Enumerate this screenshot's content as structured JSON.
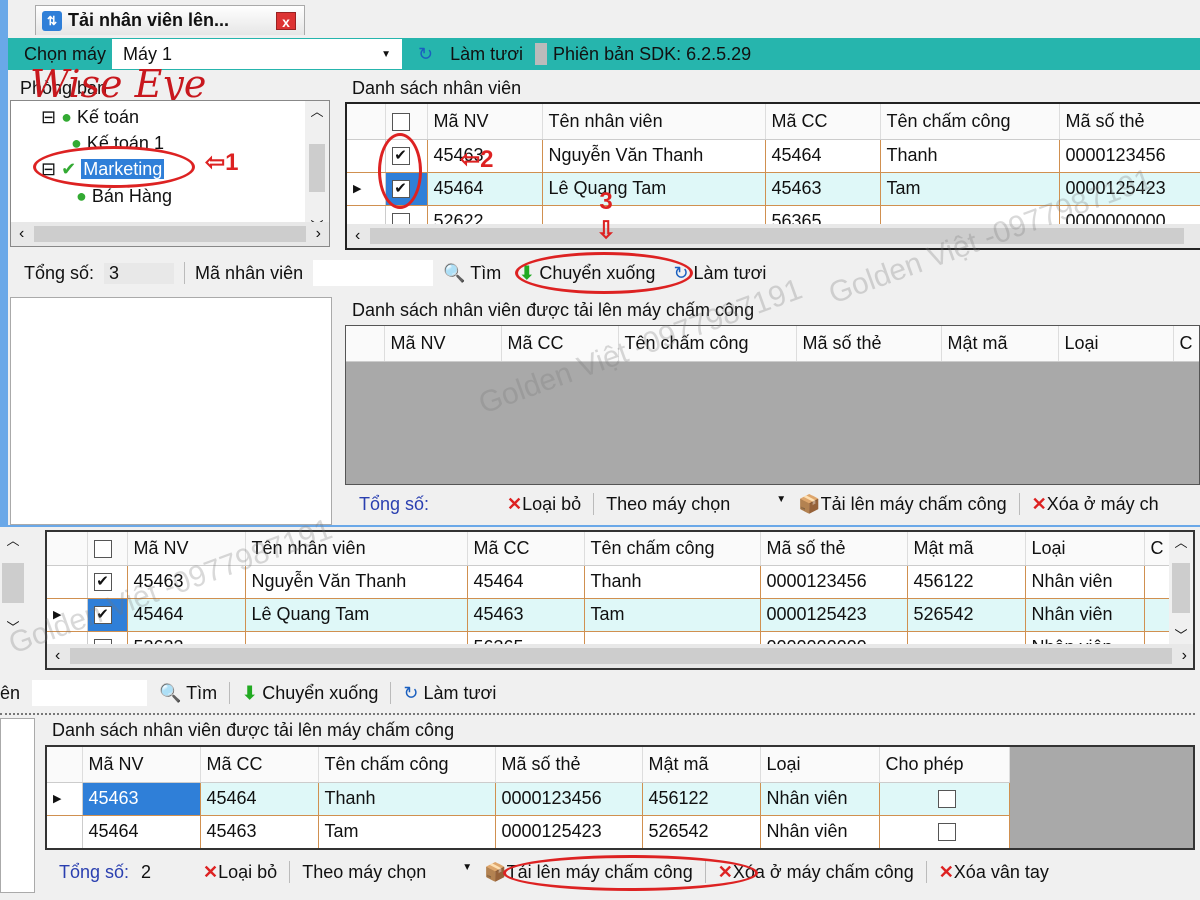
{
  "logo": "Wise Eye",
  "tab": {
    "title": "Tải nhân viên lên...",
    "close": "x"
  },
  "toolbar": {
    "choose_label": "Chọn máy",
    "machine": "Máy 1",
    "refresh": "Làm tươi",
    "sdk": "Phiên bản SDK: 6.2.5.29"
  },
  "departments": {
    "label": "Phòng ban",
    "items": [
      "Kế toán",
      "Kế toán 1",
      "Marketing",
      "Bán Hàng"
    ],
    "selected": "Marketing"
  },
  "employees": {
    "label": "Danh sách nhân viên",
    "columns": [
      "",
      "Mã NV",
      "Tên nhân viên",
      "Mã CC",
      "Tên chấm công",
      "Mã số thẻ",
      "Mật mã",
      "Loại",
      "C"
    ],
    "rows": [
      {
        "checked": true,
        "cells": [
          "45463",
          "Nguyễn Văn Thanh",
          "45464",
          "Thanh",
          "0000123456",
          "456122",
          "Nhân viên"
        ]
      },
      {
        "checked": true,
        "current": true,
        "cells": [
          "45464",
          "Lê Quang Tam",
          "45463",
          "Tam",
          "0000125423",
          "526542",
          "Nhân viên"
        ]
      },
      {
        "checked": false,
        "cells": [
          "52622",
          "",
          "56365",
          "",
          "0000000000",
          "",
          "Nhân viên"
        ]
      }
    ]
  },
  "search_bar": {
    "total_label": "Tổng số:",
    "total": "3",
    "emp_code_label": "Mã nhân viên",
    "emp_code_short": "ên",
    "find": "Tìm",
    "move_down": "Chuyển xuống",
    "refresh": "Làm tươi"
  },
  "upload": {
    "label": "Danh sách nhân viên được tải lên máy chấm công",
    "columns": [
      "Mã NV",
      "Mã CC",
      "Tên chấm công",
      "Mã số thẻ",
      "Mật mã",
      "Loại",
      "Cho phép"
    ],
    "rows": [
      {
        "current": true,
        "cells": [
          "45463",
          "45464",
          "Thanh",
          "0000123456",
          "456122",
          "Nhân viên"
        ],
        "allow": false
      },
      {
        "cells": [
          "45464",
          "45463",
          "Tam",
          "0000125423",
          "526542",
          "Nhân viên"
        ],
        "allow": false
      }
    ]
  },
  "upload_bar": {
    "total_label": "Tổng số:",
    "total_after": "2",
    "remove": "Loại bỏ",
    "mode": "Theo máy chọn",
    "upload": "Tải lên máy chấm công",
    "delete_on_machine": "Xóa ở máy chấm công",
    "delete_on_machine_short": "Xóa ở máy ch",
    "delete_fingerprint": "Xóa vân tay"
  },
  "annotations": [
    "1",
    "2",
    "3"
  ],
  "watermark": "Golden Việt -0977987191",
  "colors": {
    "teal": "#26b5ad",
    "grid_border": "#d09050",
    "selected_row": "#dff8f8",
    "annotation": "#d22222"
  }
}
